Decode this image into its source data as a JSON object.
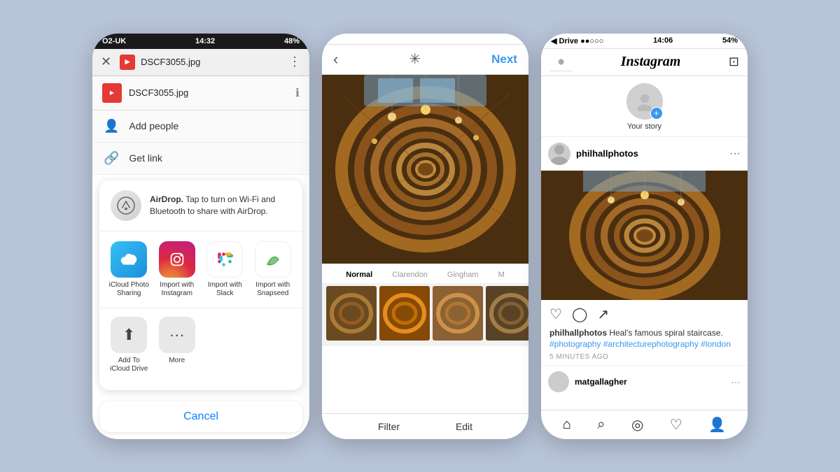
{
  "background": "#b8c4d8",
  "phones": {
    "left": {
      "statusBar": {
        "signal": "●●○○○",
        "carrier": "O2-UK",
        "wifi": "wifi",
        "time": "14:32",
        "battery": "48%"
      },
      "header": {
        "filename": "DSCF3055.jpg",
        "closeLabel": "✕",
        "moreLabel": "⋮"
      },
      "subheader": {
        "filename": "DSCF3055.jpg",
        "infoLabel": "ℹ"
      },
      "menuItems": [
        {
          "icon": "👤",
          "label": "Add people"
        },
        {
          "icon": "🔗",
          "label": "Get link"
        }
      ],
      "airdrop": {
        "title": "AirDrop.",
        "text": "Tap to turn on Wi-Fi and Bluetooth to share with AirDrop."
      },
      "apps": [
        {
          "name": "iCloud Photo Sharing",
          "type": "icloud"
        },
        {
          "name": "Import with Instagram",
          "type": "instagram"
        },
        {
          "name": "Import with Slack",
          "type": "slack"
        },
        {
          "name": "Import with Snapseed",
          "type": "snapseed"
        }
      ],
      "actions": [
        {
          "name": "Add To iCloud Drive",
          "icon": "⬆"
        },
        {
          "name": "More",
          "icon": "···"
        }
      ],
      "cancelLabel": "Cancel"
    },
    "middle": {
      "statusBar": {
        "time": "",
        "battery": ""
      },
      "nextLabel": "Next",
      "filterLabels": [
        "Normal",
        "Clarendon",
        "Gingham",
        "M"
      ],
      "footerButtons": [
        "Filter",
        "Edit"
      ]
    },
    "right": {
      "statusBar": {
        "drive": "Drive",
        "signal": "●●○○○",
        "wifi": "wifi",
        "time": "14:06",
        "battery": "54%"
      },
      "header": {
        "back": "Drive",
        "title": "Instagram",
        "inboxIcon": "⊡"
      },
      "story": {
        "label": "Your story"
      },
      "post": {
        "username": "philhallphotos",
        "moreIcon": "...",
        "caption": "Heal's famous spiral staircase.",
        "hashtags": "#photography #architecturephotography #london",
        "timeAgo": "5 MINUTES AGO"
      },
      "suggested": {
        "username": "matgallagher"
      },
      "footerIcons": [
        "🏠",
        "🔍",
        "📷",
        "♡",
        "👤"
      ]
    }
  }
}
